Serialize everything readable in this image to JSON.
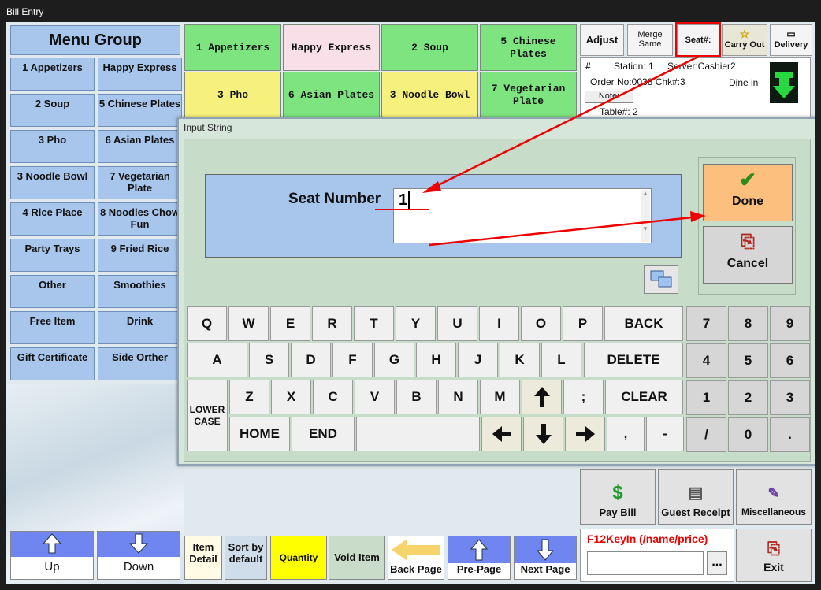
{
  "window": {
    "title": "Bill Entry"
  },
  "menu_group": {
    "title": "Menu Group",
    "items": [
      "1 Appetizers",
      "Happy Express",
      "2 Soup",
      "5 Chinese Plates",
      "3 Pho",
      "6 Asian Plates",
      "3 Noodle Bowl",
      "7 Vegetarian Plate",
      "4 Rice Place",
      "8 Noodles Chow Fun",
      "Party Trays",
      "9 Fried Rice",
      "Other",
      "Smoothies",
      "Free Item",
      "Drink",
      "Gift Certificate",
      "Side Orther"
    ]
  },
  "menu_items": [
    "1 Appetizers",
    "Happy Express",
    "2 Soup",
    "5 Chinese Plates",
    "3 Pho",
    "6 Asian Plates",
    "3 Noodle Bowl",
    "7 Vegetarian Plate"
  ],
  "top_buttons": {
    "adjust": "Adjust",
    "merge": "Merge Same",
    "seat": "Seat#:",
    "carry_out": "Carry Out",
    "delivery": "Delivery"
  },
  "order": {
    "hash": "#",
    "station": "Station: 1",
    "server": "Server:Cashier2",
    "order_no": "Order No:0038 Chk#:3",
    "dine": "Dine in",
    "note": "Note:",
    "table": "Table#: 2"
  },
  "dialog": {
    "title": "Input String",
    "seat_label": "Seat Number",
    "seat_value": "1",
    "done": "Done",
    "cancel": "Cancel"
  },
  "keyboard": {
    "row1": [
      "Q",
      "W",
      "E",
      "R",
      "T",
      "Y",
      "U",
      "I",
      "O",
      "P",
      "BACK"
    ],
    "row2": [
      "A",
      "S",
      "D",
      "F",
      "G",
      "H",
      "J",
      "K",
      "L",
      "DELETE"
    ],
    "row3": [
      "Z",
      "X",
      "C",
      "V",
      "B",
      "N",
      "M"
    ],
    "lower": "LOWER CASE",
    "semicolon": ";",
    "clear": "CLEAR",
    "home": "HOME",
    "end": "END",
    "comma": ",",
    "minus": "-",
    "numpad": [
      "7",
      "8",
      "9",
      "4",
      "5",
      "6",
      "1",
      "2",
      "3",
      "/",
      "0",
      "."
    ]
  },
  "bottom": {
    "up": "Up",
    "down": "Down",
    "item_detail": "Item Detail",
    "sort": "Sort by default",
    "quantity": "Quantity",
    "void": "Void Item",
    "back_page": "Back Page",
    "pre_page": "Pre-Page",
    "next_page": "Next Page",
    "pay_bill": "Pay Bill",
    "guest_receipt": "Guest Receipt",
    "misc": "Miscellaneous",
    "f12": "F12KeyIn (/name/price)",
    "dots": "...",
    "exit": "Exit"
  }
}
